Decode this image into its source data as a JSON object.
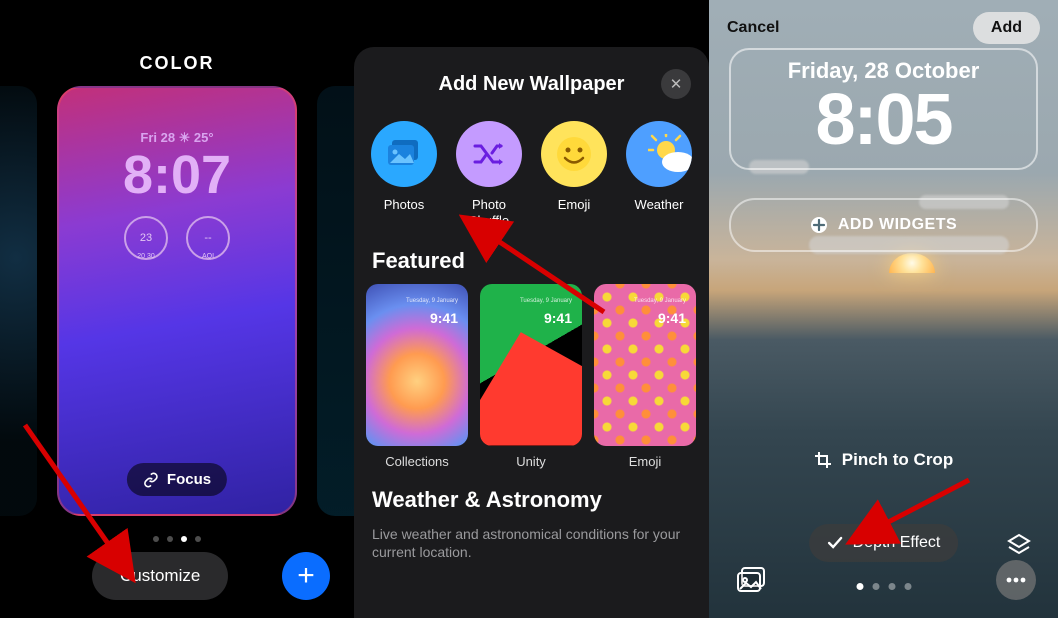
{
  "screen1": {
    "heading": "COLOR",
    "lock_date": "Fri 28  ☀  25°",
    "lock_time": "8:07",
    "widget1_value": "23",
    "widget1_sub": "20  30",
    "widget2_value": "--",
    "widget2_sub": "AQI",
    "focus_label": "Focus",
    "customize_label": "Customize",
    "add_label": "+"
  },
  "screen2": {
    "title": "Add New Wallpaper",
    "categories": [
      {
        "label": "Photos"
      },
      {
        "label": "Photo Shuffle"
      },
      {
        "label": "Emoji"
      },
      {
        "label": "Weather"
      }
    ],
    "featured_heading": "Featured",
    "thumb_date": "Tuesday, 9 January",
    "thumb_time": "9:41",
    "featured_items": [
      {
        "label": "Collections"
      },
      {
        "label": "Unity"
      },
      {
        "label": "Emoji"
      }
    ],
    "weather_heading": "Weather & Astronomy",
    "weather_sub": "Live weather and astronomical conditions for your current location."
  },
  "screen3": {
    "cancel_label": "Cancel",
    "add_label": "Add",
    "date": "Friday, 28 October",
    "time": "8:05",
    "add_widgets_label": "ADD WIDGETS",
    "pinch_label": "Pinch to Crop",
    "depth_label": "Depth Effect"
  }
}
